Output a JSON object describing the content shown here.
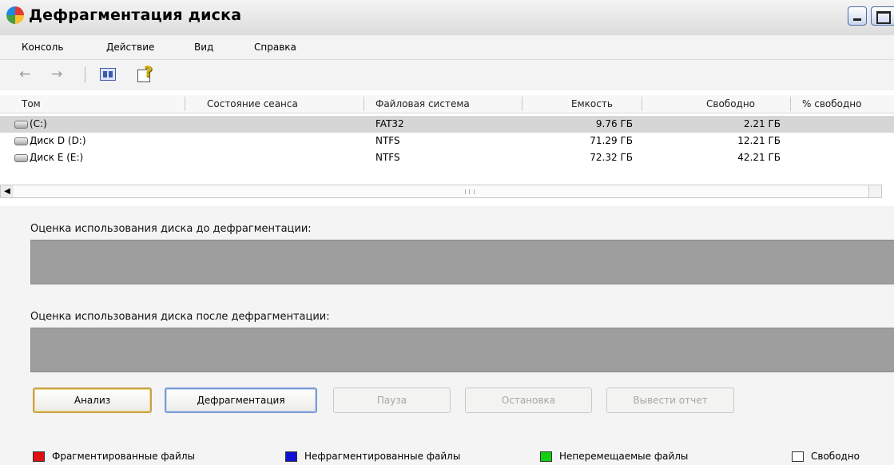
{
  "window": {
    "title": "Дефрагментация диска"
  },
  "menu": {
    "items": [
      "Консоль",
      "Действие",
      "Вид",
      "Справка"
    ]
  },
  "toolbar": {
    "back_icon": "←",
    "forward_icon": "→"
  },
  "volumes": {
    "columns": [
      "Том",
      "Состояние сеанса",
      "Файловая система",
      "Емкость",
      "Свободно",
      "% свободно"
    ],
    "rows": [
      {
        "name": "(C:)",
        "status": "",
        "fs": "FAT32",
        "capacity": "9.76 ГБ",
        "free": "2.21 ГБ",
        "selected": true
      },
      {
        "name": "Диск D (D:)",
        "status": "",
        "fs": "NTFS",
        "capacity": "71.29 ГБ",
        "free": "12.21 ГБ",
        "selected": false
      },
      {
        "name": "Диск E (E:)",
        "status": "",
        "fs": "NTFS",
        "capacity": "72.32 ГБ",
        "free": "42.21 ГБ",
        "selected": false
      }
    ]
  },
  "usage": {
    "before_label": "Оценка использования диска до дефрагментации:",
    "after_label": "Оценка использования диска после дефрагментации:"
  },
  "buttons": {
    "analyze": "Анализ",
    "defragment": "Дефрагментация",
    "pause": "Пауза",
    "stop": "Остановка",
    "report": "Вывести отчет"
  },
  "legend": [
    {
      "label": "Фрагментированные файлы",
      "color": "#e01010"
    },
    {
      "label": "Нефрагментированные файлы",
      "color": "#1010d0"
    },
    {
      "label": "Неперемещаемые файлы",
      "color": "#10d010"
    },
    {
      "label": "Свободно",
      "color": "#ffffff"
    }
  ],
  "colors": {
    "accent": "#316ac5",
    "bar_gray": "#9e9e9e"
  }
}
